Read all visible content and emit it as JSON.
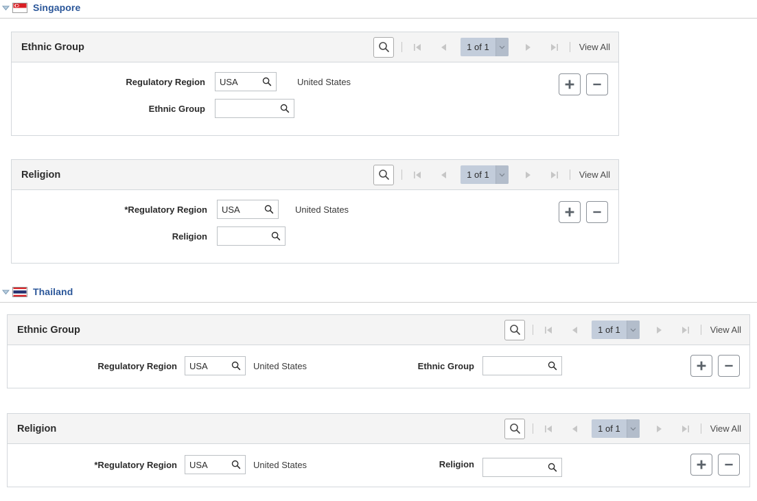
{
  "sections": [
    {
      "country": "Singapore",
      "flag": "singapore-flag",
      "expanded_icon": "collapse-triangle-icon",
      "panels": [
        {
          "title": "Ethnic Group",
          "search_icon": "search-icon",
          "first_icon": "first-page-icon",
          "prev_icon": "previous-page-icon",
          "page_indicator": "1 of 1",
          "dropdown_icon": "chevron-down-icon",
          "next_icon": "next-page-icon",
          "last_icon": "last-page-icon",
          "view_all": "View All",
          "add_icon": "add-row-icon",
          "delete_icon": "delete-row-icon",
          "fields": [
            {
              "label": "Regulatory Region",
              "value": "USA",
              "lookup_icon": "lookup-icon",
              "display": "United States"
            },
            {
              "label": "Ethnic Group",
              "value": "",
              "lookup_icon": "lookup-icon",
              "display": ""
            }
          ]
        },
        {
          "title": "Religion",
          "search_icon": "search-icon",
          "first_icon": "first-page-icon",
          "prev_icon": "previous-page-icon",
          "page_indicator": "1 of 1",
          "dropdown_icon": "chevron-down-icon",
          "next_icon": "next-page-icon",
          "last_icon": "last-page-icon",
          "view_all": "View All",
          "add_icon": "add-row-icon",
          "delete_icon": "delete-row-icon",
          "fields": [
            {
              "label": "*Regulatory Region",
              "value": "USA",
              "lookup_icon": "lookup-icon",
              "display": "United States"
            },
            {
              "label": "Religion",
              "value": "",
              "lookup_icon": "lookup-icon",
              "display": ""
            }
          ]
        }
      ]
    },
    {
      "country": "Thailand",
      "flag": "thailand-flag",
      "expanded_icon": "collapse-triangle-icon",
      "panels": [
        {
          "title": "Ethnic Group",
          "search_icon": "search-icon",
          "first_icon": "first-page-icon",
          "prev_icon": "previous-page-icon",
          "page_indicator": "1 of 1",
          "dropdown_icon": "chevron-down-icon",
          "next_icon": "next-page-icon",
          "last_icon": "last-page-icon",
          "view_all": "View All",
          "add_icon": "add-row-icon",
          "delete_icon": "delete-row-icon",
          "fields": [
            {
              "label": "Regulatory Region",
              "value": "USA",
              "lookup_icon": "lookup-icon",
              "display": "United States"
            },
            {
              "label": "Ethnic Group",
              "value": "",
              "lookup_icon": "lookup-icon",
              "display": ""
            }
          ]
        },
        {
          "title": "Religion",
          "search_icon": "search-icon",
          "first_icon": "first-page-icon",
          "prev_icon": "previous-page-icon",
          "page_indicator": "1 of 1",
          "dropdown_icon": "chevron-down-icon",
          "next_icon": "next-page-icon",
          "last_icon": "last-page-icon",
          "view_all": "View All",
          "add_icon": "add-row-icon",
          "delete_icon": "delete-row-icon",
          "fields": [
            {
              "label": "*Regulatory Region",
              "value": "USA",
              "lookup_icon": "lookup-icon",
              "display": "United States"
            },
            {
              "label": "Religion",
              "value": "",
              "lookup_icon": "lookup-icon",
              "display": ""
            }
          ]
        }
      ]
    }
  ],
  "colors": {
    "country_link": "#2a5699",
    "panel_header_bg": "#f4f4f4",
    "panel_border": "#d3d7db",
    "page_selector_bg": "#c3cddb"
  }
}
